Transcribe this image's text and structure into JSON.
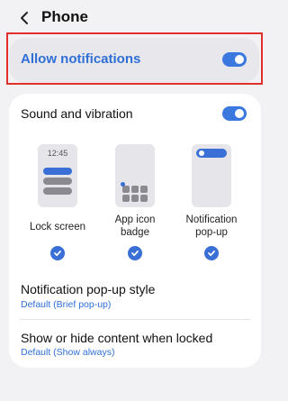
{
  "header": {
    "title": "Phone"
  },
  "allow_notifications": {
    "label": "Allow notifications",
    "enabled": true
  },
  "sound_vibration": {
    "label": "Sound and vibration",
    "enabled": true
  },
  "styles": {
    "lock_preview_time": "12:45",
    "options": [
      {
        "label": "Lock screen",
        "checked": true
      },
      {
        "label": "App icon\nbadge",
        "checked": true
      },
      {
        "label": "Notification\npop-up",
        "checked": true
      }
    ]
  },
  "popup_style": {
    "label": "Notification pop-up style",
    "value": "Default (Brief pop-up)"
  },
  "locked_content": {
    "label": "Show or hide content when locked",
    "value": "Default (Show always)"
  },
  "colors": {
    "accent": "#3a78e0",
    "highlight": "#e0302e",
    "link": "#2f6fd6"
  }
}
